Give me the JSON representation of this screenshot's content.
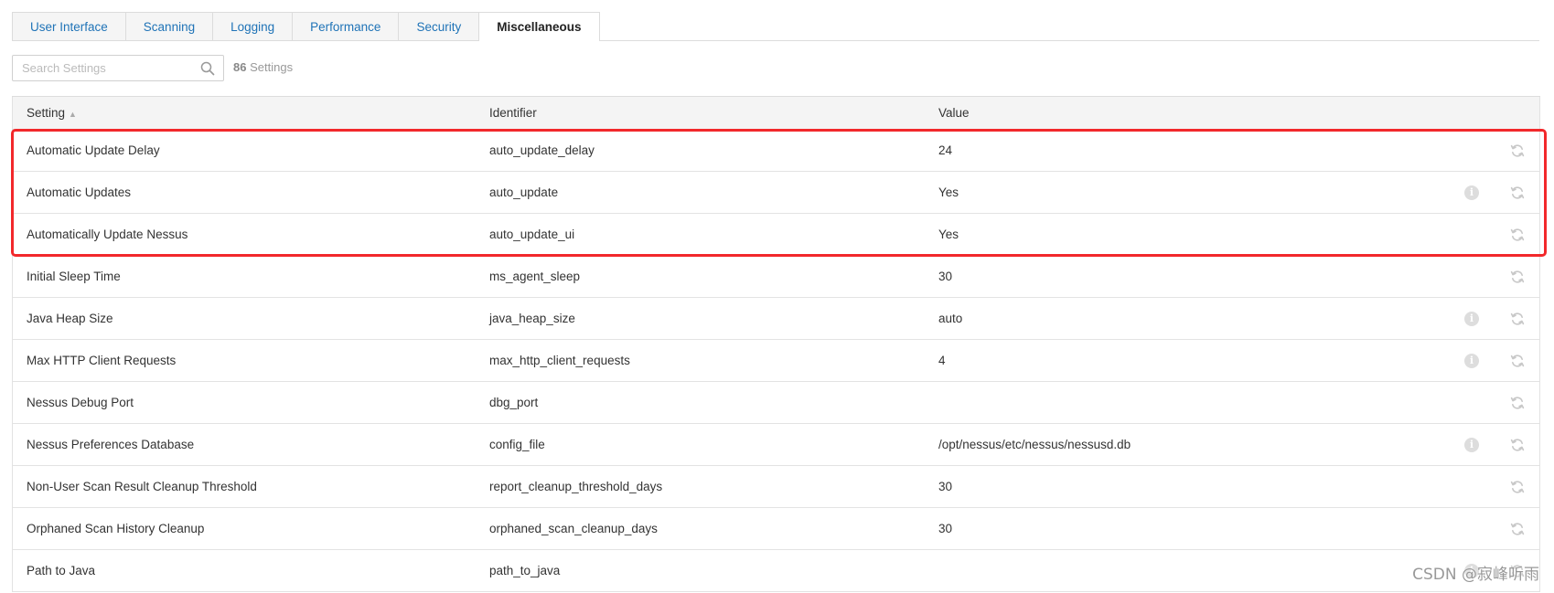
{
  "tabs": [
    {
      "label": "User Interface",
      "active": false
    },
    {
      "label": "Scanning",
      "active": false
    },
    {
      "label": "Logging",
      "active": false
    },
    {
      "label": "Performance",
      "active": false
    },
    {
      "label": "Security",
      "active": false
    },
    {
      "label": "Miscellaneous",
      "active": true
    }
  ],
  "search": {
    "placeholder": "Search Settings",
    "value": "",
    "icon": "search-icon"
  },
  "settings_count": {
    "number": "86",
    "label": "Settings"
  },
  "table": {
    "headers": {
      "setting": "Setting",
      "identifier": "Identifier",
      "value": "Value"
    },
    "sort_indicator": "▲",
    "rows": [
      {
        "setting": "Automatic Update Delay",
        "identifier": "auto_update_delay",
        "value": "24",
        "info": false
      },
      {
        "setting": "Automatic Updates",
        "identifier": "auto_update",
        "value": "Yes",
        "info": true
      },
      {
        "setting": "Automatically Update Nessus",
        "identifier": "auto_update_ui",
        "value": "Yes",
        "info": false
      },
      {
        "setting": "Initial Sleep Time",
        "identifier": "ms_agent_sleep",
        "value": "30",
        "info": false
      },
      {
        "setting": "Java Heap Size",
        "identifier": "java_heap_size",
        "value": "auto",
        "info": true
      },
      {
        "setting": "Max HTTP Client Requests",
        "identifier": "max_http_client_requests",
        "value": "4",
        "info": true
      },
      {
        "setting": "Nessus Debug Port",
        "identifier": "dbg_port",
        "value": "",
        "info": false
      },
      {
        "setting": "Nessus Preferences Database",
        "identifier": "config_file",
        "value": "/opt/nessus/etc/nessus/nessusd.db",
        "info": true
      },
      {
        "setting": "Non-User Scan Result Cleanup Threshold",
        "identifier": "report_cleanup_threshold_days",
        "value": "30",
        "info": false
      },
      {
        "setting": "Orphaned Scan History Cleanup",
        "identifier": "orphaned_scan_cleanup_days",
        "value": "30",
        "info": false
      },
      {
        "setting": "Path to Java",
        "identifier": "path_to_java",
        "value": "",
        "info": true
      }
    ]
  },
  "icons": {
    "info": "info-icon",
    "reset": "refresh-icon"
  },
  "info_glyph": "i",
  "colors": {
    "link": "#1f73b7",
    "highlight": "#f2282b",
    "header_bg": "#f4f4f4"
  },
  "watermark": "CSDN @寂峰听雨"
}
